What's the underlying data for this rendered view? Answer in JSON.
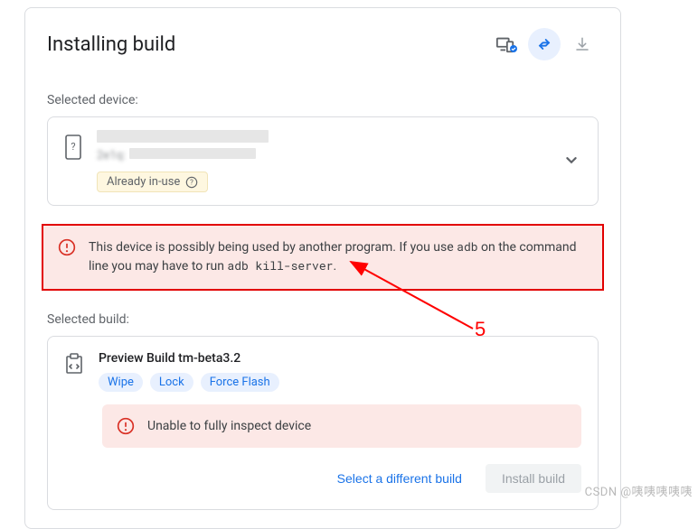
{
  "header": {
    "title": "Installing build"
  },
  "device": {
    "section_label": "Selected device:",
    "line2_prefix": "2e1q:",
    "badge_label": "Already in-use"
  },
  "alert": {
    "text_before": "This device is possibly being used by another program. If you use ",
    "code1": "adb",
    "text_mid": " on the command line you may have to run ",
    "code2": "adb kill-server",
    "text_after": "."
  },
  "build": {
    "section_label": "Selected build:",
    "title": "Preview Build tm-beta3.2",
    "chips": {
      "wipe": "Wipe",
      "lock": "Lock",
      "force_flash": "Force Flash"
    },
    "inner_alert": "Unable to fully inspect device",
    "select_btn": "Select a different build",
    "install_btn": "Install build"
  },
  "annotation": {
    "number": "5"
  },
  "watermark": "CSDN @咦咦咦咦咦"
}
